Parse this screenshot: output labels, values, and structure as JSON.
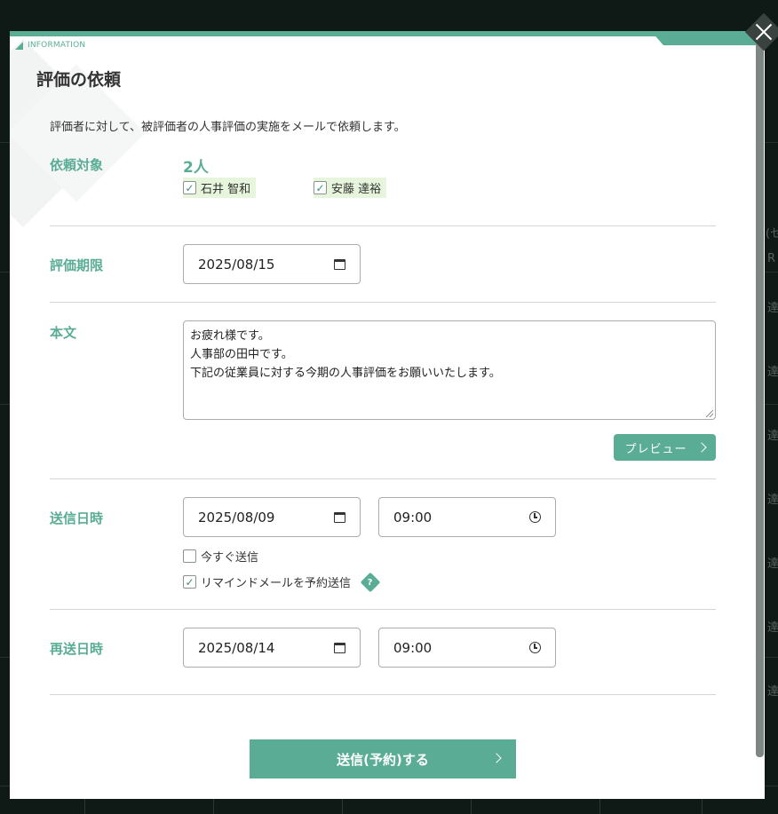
{
  "modal": {
    "info_label": "INFORMATION",
    "title": "評価の依頼",
    "description": "評価者に対して、被評価者の人事評価の実施をメールで依頼します。"
  },
  "target": {
    "label": "依頼対象",
    "count": "2人",
    "people": [
      {
        "name": "石井 智和",
        "checked": true
      },
      {
        "name": "安藤 達裕",
        "checked": true
      }
    ]
  },
  "deadline": {
    "label": "評価期限",
    "date": "2025/08/15"
  },
  "body": {
    "label": "本文",
    "lines": [
      "お疲れ様です。",
      "人事部の田中です。",
      "下記の従業員に対する今期の人事評価をお願いいたします。"
    ],
    "preview_label": "プレビュー"
  },
  "send": {
    "label": "送信日時",
    "date": "2025/08/09",
    "time": "09:00",
    "send_now_label": "今すぐ送信",
    "send_now_checked": false,
    "reminder_label": "リマインドメールを予約送信",
    "reminder_checked": true
  },
  "resend": {
    "label": "再送日時",
    "date": "2025/08/14",
    "time": "09:00"
  },
  "submit_label": "送信(予約)する",
  "colors": {
    "accent": "#5aac95",
    "highlight": "#e6f5db",
    "overlay": "#0f1a17"
  },
  "background_glyphs": [
    "(セ",
    "R",
    "達",
    "達",
    "達",
    "達",
    "達",
    "達",
    "達"
  ]
}
